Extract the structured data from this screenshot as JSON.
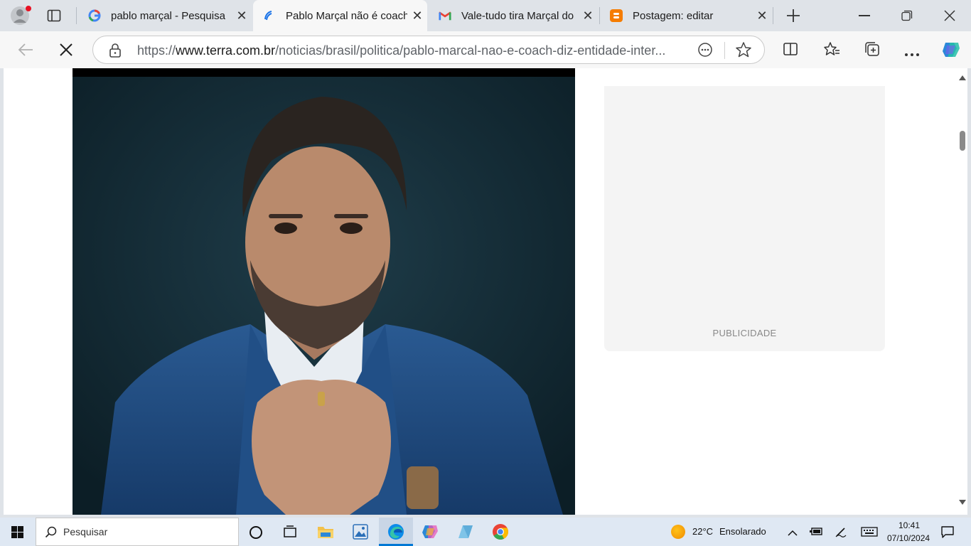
{
  "tabs": [
    {
      "title": "pablo marçal - Pesquisa",
      "icon": "google-icon",
      "active": false
    },
    {
      "title": "Pablo Marçal não é coach",
      "icon": "terra-icon",
      "active": true
    },
    {
      "title": "Vale-tudo tira Marçal do",
      "icon": "gmail-icon",
      "active": false
    },
    {
      "title": "Postagem: editar",
      "icon": "blogger-icon",
      "active": false
    }
  ],
  "address": {
    "prefix": "https://",
    "domain": "www.terra.com.br",
    "path": "/noticias/brasil/politica/pablo-marcal-nao-e-coach-diz-entidade-inter..."
  },
  "ad": {
    "label": "PUBLICIDADE"
  },
  "taskbar": {
    "search_placeholder": "Pesquisar",
    "weather_temp": "22°C",
    "weather_desc": "Ensolarado",
    "time": "10:41",
    "date": "07/10/2024"
  },
  "colors": {
    "accent": "#0078d4",
    "tabstrip": "#dfe3e8",
    "toolbar": "#f7f7f7"
  }
}
